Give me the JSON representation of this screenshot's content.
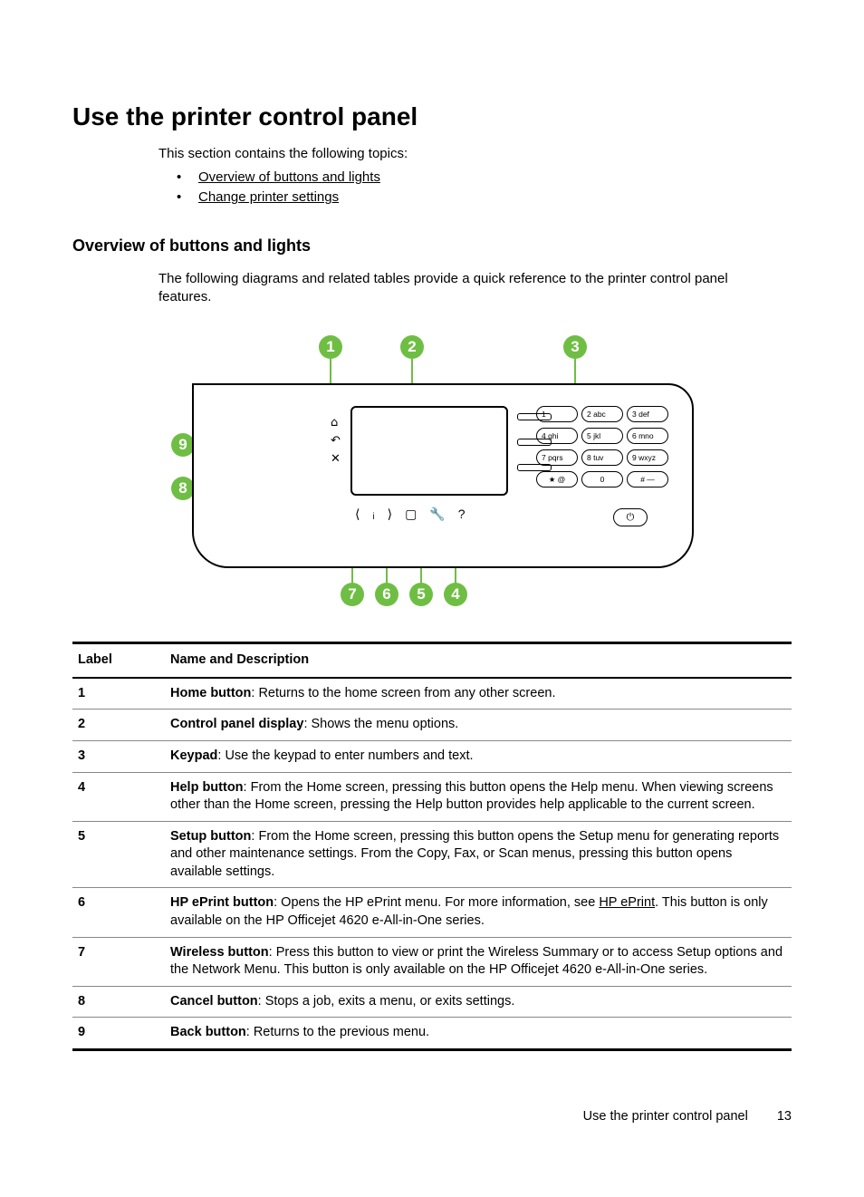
{
  "heading": "Use the printer control panel",
  "intro": "This section contains the following topics:",
  "links": [
    "Overview of buttons and lights",
    "Change printer settings"
  ],
  "subheading": "Overview of buttons and lights",
  "sub_intro": "The following diagrams and related tables provide a quick reference to the printer control panel features.",
  "callouts": [
    "1",
    "2",
    "3",
    "4",
    "5",
    "6",
    "7",
    "8",
    "9"
  ],
  "keypad": [
    {
      "n": "1",
      "t": ""
    },
    {
      "n": "2",
      "t": "abc"
    },
    {
      "n": "3",
      "t": "def"
    },
    {
      "n": "4",
      "t": "ghi"
    },
    {
      "n": "5",
      "t": "jkl"
    },
    {
      "n": "6",
      "t": "mno"
    },
    {
      "n": "7",
      "t": "pqrs"
    },
    {
      "n": "8",
      "t": "tuv"
    },
    {
      "n": "9",
      "t": "wxyz"
    },
    {
      "n": "★",
      "t": "@"
    },
    {
      "n": "0",
      "t": ""
    },
    {
      "n": "#",
      "t": "—"
    }
  ],
  "nav_icons": {
    "home": "⌂",
    "back": "↶",
    "cancel": "✕"
  },
  "bottom_icons": {
    "wireless": "⟨ᵢ⟩",
    "eprint": "▢",
    "setup": "🔧",
    "help": "?"
  },
  "power_icon": "⏻",
  "table": {
    "headers": [
      "Label",
      "Name and Description"
    ],
    "rows": [
      {
        "n": "1",
        "bold": "Home button",
        "rest": ": Returns to the home screen from any other screen."
      },
      {
        "n": "2",
        "bold": "Control panel display",
        "rest": ": Shows the menu options."
      },
      {
        "n": "3",
        "bold": "Keypad",
        "rest": ": Use the keypad to enter numbers and text."
      },
      {
        "n": "4",
        "bold": "Help button",
        "rest": ": From the Home screen, pressing this button opens the Help menu. When viewing screens other than the Home screen, pressing the Help button provides help applicable to the current screen."
      },
      {
        "n": "5",
        "bold": "Setup button",
        "rest": ": From the Home screen, pressing this button opens the Setup menu for generating reports and other maintenance settings. From the Copy, Fax, or Scan menus, pressing this button opens available settings."
      },
      {
        "n": "6",
        "bold": "HP ePrint button",
        "rest_pre": ": Opens the HP ePrint menu. For more information, see ",
        "link": "HP ePrint",
        "rest_post": ". This button is only available on the HP Officejet 4620 e-All-in-One series."
      },
      {
        "n": "7",
        "bold": "Wireless button",
        "rest": ": Press this button to view or print the Wireless Summary or to access Setup options and the Network Menu. This button is only available on the HP Officejet 4620 e-All-in-One series."
      },
      {
        "n": "8",
        "bold": "Cancel button",
        "rest": ": Stops a job, exits a menu, or exits settings."
      },
      {
        "n": "9",
        "bold": "Back button",
        "rest": ": Returns to the previous menu."
      }
    ]
  },
  "footer_text": "Use the printer control panel",
  "page_number": "13"
}
